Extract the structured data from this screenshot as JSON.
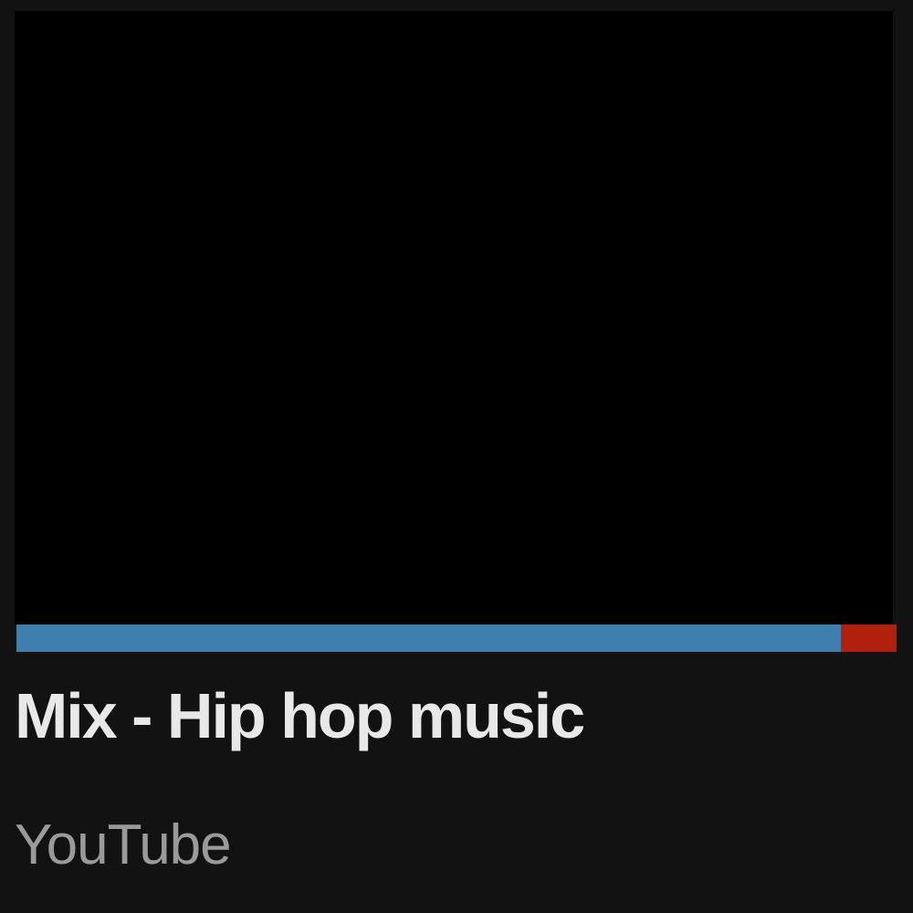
{
  "video": {
    "title": "Mix - Hip hop music",
    "channel": "YouTube",
    "watched_fraction": 0.937
  },
  "colors": {
    "background": "#121212",
    "thumbnail": "#000000",
    "progress_watched": "#3f7fb0",
    "progress_remaining": "#b0200c",
    "title_text": "#e8e8e8",
    "channel_text": "#9a9a9a"
  }
}
